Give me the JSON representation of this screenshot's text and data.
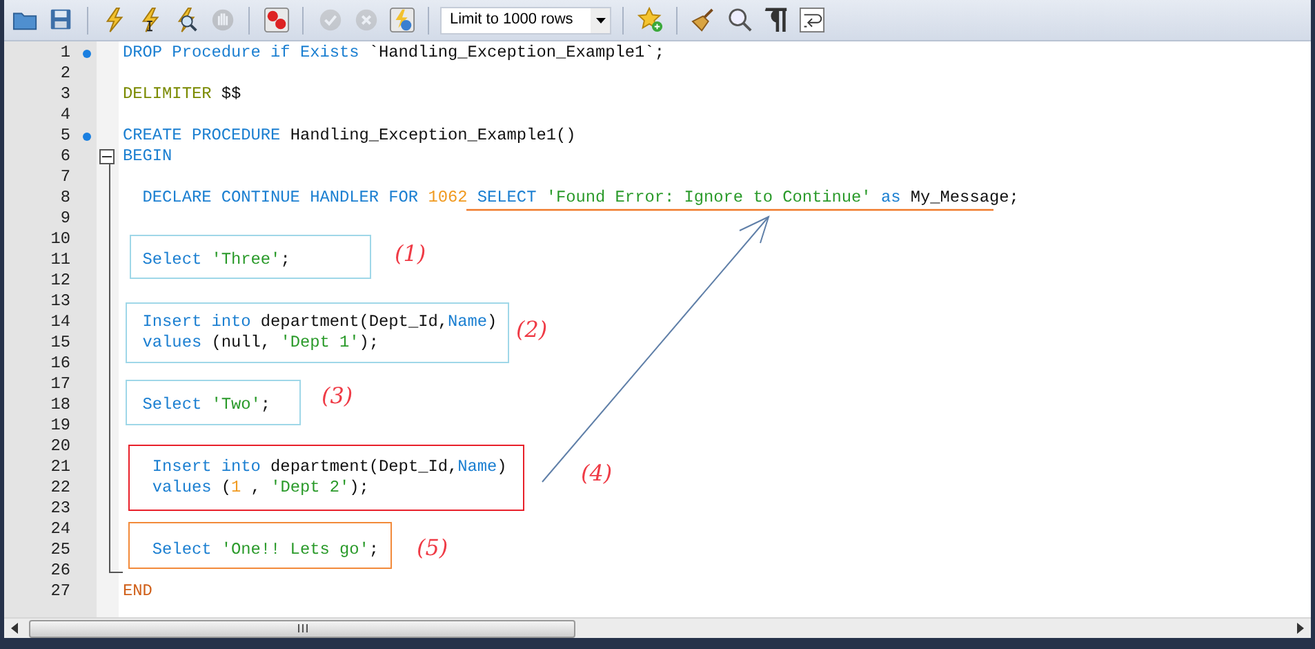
{
  "toolbar": {
    "buttons": [
      {
        "disabled": false
      },
      {
        "disabled": false
      },
      {
        "disabled": false
      },
      {
        "disabled": false
      },
      {
        "disabled": false
      },
      {
        "disabled": true
      },
      {
        "disabled": false
      },
      {
        "disabled": true
      },
      {
        "disabled": true
      },
      {
        "disabled": false
      }
    ],
    "limit_select": {
      "value": "Limit to 1000 rows"
    },
    "buttons_after": [
      {
        "disabled": false
      },
      {
        "disabled": false
      },
      {
        "disabled": false
      },
      {
        "disabled": false
      },
      {
        "disabled": false
      }
    ]
  },
  "editor": {
    "lines": [
      {
        "number": "1",
        "marker": true,
        "tokens": [
          {
            "kind": "keyword",
            "text": "DROP Procedure if Exists "
          },
          {
            "kind": "plain",
            "text": "`Handling_Exception_Example1`;"
          }
        ]
      },
      {
        "number": "2",
        "marker": false
      },
      {
        "number": "3",
        "marker": false,
        "tokens": [
          {
            "kind": "directive",
            "text": "DELIMITER "
          },
          {
            "kind": "plain",
            "text": "$$"
          }
        ]
      },
      {
        "number": "4",
        "marker": false
      },
      {
        "number": "5",
        "marker": true,
        "tokens": [
          {
            "kind": "keyword",
            "text": "CREATE PROCEDURE "
          },
          {
            "kind": "plain",
            "text": "Handling_Exception_Example1()"
          }
        ]
      },
      {
        "number": "6",
        "marker": false,
        "expanded": true,
        "tokens": [
          {
            "kind": "keyword",
            "text": "BEGIN"
          }
        ],
        "children": [
          {
            "number": "7",
            "marker": false
          },
          {
            "number": "8",
            "marker": false,
            "tokens": [
              {
                "kind": "keyword",
                "text": "  DECLARE CONTINUE HANDLER FOR "
              },
              {
                "kind": "number",
                "text": "1062"
              },
              {
                "kind": "keyword",
                "text": " SELECT "
              },
              {
                "kind": "string",
                "text": "'Found Error: Ignore to Continue'"
              },
              {
                "kind": "keyword",
                "text": " as "
              },
              {
                "kind": "plain",
                "text": "My_Message;"
              }
            ]
          },
          {
            "number": "9",
            "marker": false
          },
          {
            "number": "10",
            "marker": false
          },
          {
            "number": "11",
            "marker": false,
            "tokens": [
              {
                "kind": "keyword",
                "text": "  Select "
              },
              {
                "kind": "string",
                "text": "'Three'"
              },
              {
                "kind": "plain",
                "text": ";"
              }
            ]
          },
          {
            "number": "12",
            "marker": false
          },
          {
            "number": "13",
            "marker": false
          },
          {
            "number": "14",
            "marker": false,
            "tokens": [
              {
                "kind": "keyword",
                "text": "  Insert into "
              },
              {
                "kind": "plain",
                "text": "department(Dept_Id,"
              },
              {
                "kind": "keyword",
                "text": "Name"
              },
              {
                "kind": "plain",
                "text": ")"
              }
            ]
          },
          {
            "number": "15",
            "marker": false,
            "tokens": [
              {
                "kind": "keyword",
                "text": "  values "
              },
              {
                "kind": "plain",
                "text": "(null, "
              },
              {
                "kind": "string",
                "text": "'Dept 1'"
              },
              {
                "kind": "plain",
                "text": ");"
              }
            ]
          },
          {
            "number": "16",
            "marker": false
          },
          {
            "number": "17",
            "marker": false
          },
          {
            "number": "18",
            "marker": false,
            "tokens": [
              {
                "kind": "keyword",
                "text": "  Select "
              },
              {
                "kind": "string",
                "text": "'Two'"
              },
              {
                "kind": "plain",
                "text": ";"
              }
            ]
          },
          {
            "number": "19",
            "marker": false
          },
          {
            "number": "20",
            "marker": false
          },
          {
            "number": "21",
            "marker": false,
            "tokens": [
              {
                "kind": "keyword",
                "text": "   Insert into "
              },
              {
                "kind": "plain",
                "text": "department(Dept_Id,"
              },
              {
                "kind": "keyword",
                "text": "Name"
              },
              {
                "kind": "plain",
                "text": ")"
              }
            ]
          },
          {
            "number": "22",
            "marker": false,
            "tokens": [
              {
                "kind": "keyword",
                "text": "   values "
              },
              {
                "kind": "plain",
                "text": "("
              },
              {
                "kind": "number",
                "text": "1"
              },
              {
                "kind": "plain",
                "text": " , "
              },
              {
                "kind": "string",
                "text": "'Dept 2'"
              },
              {
                "kind": "plain",
                "text": ");"
              }
            ]
          },
          {
            "number": "23",
            "marker": false
          },
          {
            "number": "24",
            "marker": false
          },
          {
            "number": "25",
            "marker": false,
            "tokens": [
              {
                "kind": "keyword",
                "text": "   Select "
              },
              {
                "kind": "string",
                "text": "'One!! Lets go'"
              },
              {
                "kind": "plain",
                "text": ";"
              }
            ]
          },
          {
            "number": "26",
            "marker": false
          }
        ]
      },
      {
        "number": "27",
        "marker": false,
        "tokens": [
          {
            "kind": "end",
            "text": "END"
          }
        ]
      }
    ]
  },
  "annotations": [
    {
      "label": "(1)",
      "color": "#9fd7e8"
    },
    {
      "label": "(2)",
      "color": "#9fd7e8"
    },
    {
      "label": "(3)",
      "color": "#9fd7e8"
    },
    {
      "label": "(4)",
      "color": "#e8202a"
    },
    {
      "label": "(5)",
      "color": "#f28a3a"
    }
  ]
}
